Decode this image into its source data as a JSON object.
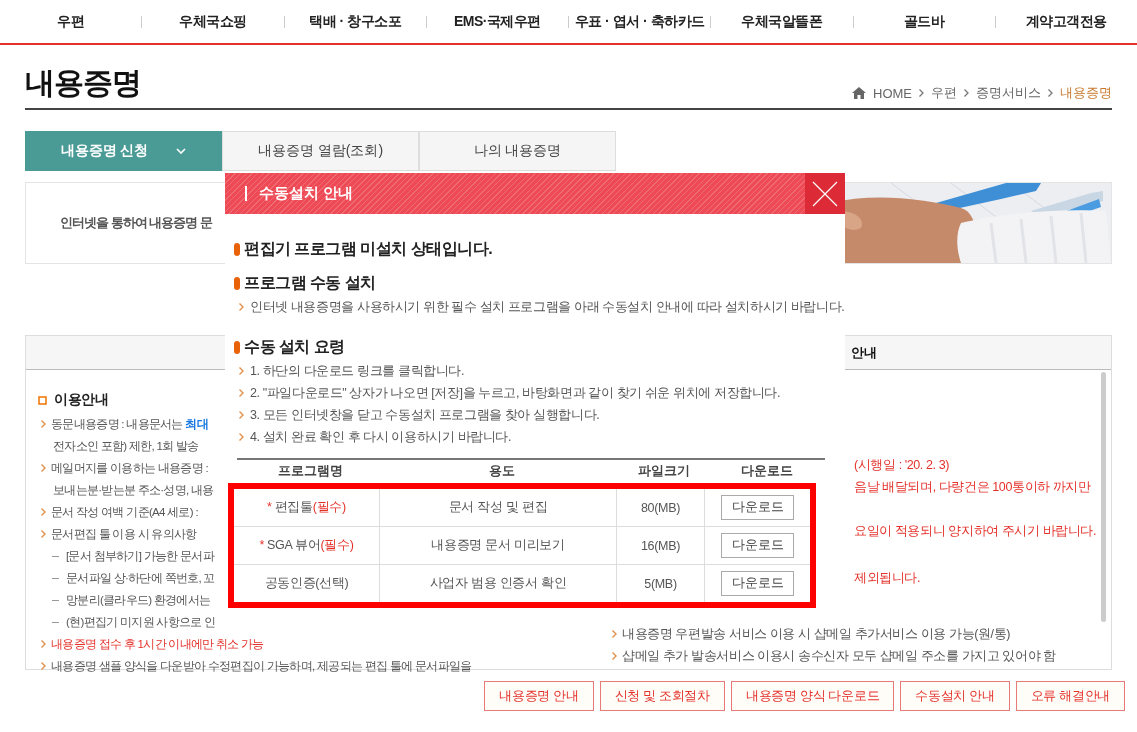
{
  "nav": [
    "우편",
    "우체국쇼핑",
    "택배 · 창구소포",
    "EMS·국제우편",
    "우표 · 엽서 · 축하카드",
    "우체국알뜰폰",
    "골드바",
    "계약고객전용"
  ],
  "page_title": "내용증명",
  "breadcrumb": [
    {
      "kind": "home",
      "label": "HOME",
      "selected": false
    },
    {
      "kind": "link",
      "label": "우편",
      "selected": false
    },
    {
      "kind": "link",
      "label": "증명서비스",
      "selected": false
    },
    {
      "kind": "link",
      "label": "내용증명",
      "selected": true
    }
  ],
  "tabs": [
    {
      "label": "내용증명 신청",
      "selected": true
    },
    {
      "label": "내용증명 열람(조회)",
      "selected": false
    },
    {
      "label": "나의 내용증명",
      "selected": false
    }
  ],
  "intro": {
    "text": "인터넷을 통하여 내용증명 문"
  },
  "info": {
    "header": "안내",
    "left": [
      {
        "kind": "heading",
        "text": "이용안내",
        "alert": false
      },
      {
        "kind": "bullet",
        "text": "동문내용증명 : 내용문서는 **최대**",
        "alert": false
      },
      {
        "kind": "cont",
        "text": "전자소인 포함) 제한, 1회 발송",
        "alert": false
      },
      {
        "kind": "bullet",
        "text": "메일머지를 이용하는 내용증명 :",
        "alert": false
      },
      {
        "kind": "cont",
        "text": "보내는분·받는분 주소·성명, 내용",
        "alert": false
      },
      {
        "kind": "bullet",
        "text": "문서 작성 여백 기준(A4 세로) :",
        "alert": false
      },
      {
        "kind": "bullet",
        "text": "문서편집 툴 이용 시 유의사항",
        "alert": false
      },
      {
        "kind": "dash",
        "text": "[문서 첨부하기] 가능한 문서파",
        "alert": false
      },
      {
        "kind": "dash",
        "text": "문서파일 상·하단에 쪽번호, 꼬",
        "alert": false
      },
      {
        "kind": "dash",
        "text": "망분리(클라우드) 환경에서는",
        "alert": false
      },
      {
        "kind": "dash",
        "text": "(현)편집기 미지원 사항으로 인",
        "alert": false
      },
      {
        "kind": "bullet",
        "text": "내용증명 접수 후 1시간 이내에만 취소 가능",
        "alert": true
      },
      {
        "kind": "bullet",
        "text": "내용증명 샘플 양식을 다운받아 수정편집이 가능하며, 제공되는 편집 툴에 문서파일을",
        "alert": false
      }
    ],
    "right": [
      {
        "kind": "tail",
        "text": "(시행일 : '20. 2. 3)",
        "alert": true
      },
      {
        "kind": "tail",
        "text": "음날 배달되며, 다량건은 100통이하 까지만",
        "alert": true
      },
      {
        "kind": "tail",
        "text": "요일이 적용되니 양지하여 주시기 바랍니다.",
        "alert": true
      },
      {
        "kind": "tail",
        "text": "제외됩니다.",
        "alert": true
      },
      {
        "kind": "bullet",
        "text": "내용증명 우편발송 서비스 이용 시 샵메일 추가서비스 이용 가능(원/통)",
        "alert": false
      },
      {
        "kind": "bullet",
        "text": "샵메일 추가 발송서비스 이용시 송수신자 모두 샵메일 주소를 가지고 있어야 함",
        "alert": false
      }
    ]
  },
  "bottom_buttons": [
    "내용증명 안내",
    "신청 및 조회절차",
    "내용증명 양식 다운로드",
    "수동설치 안내",
    "오류 해결안내"
  ],
  "dialog": {
    "title": "수동설치 안내",
    "sections": [
      {
        "heading": "편집기 프로그램 미설치 상태입니다."
      },
      {
        "heading": "프로그램 수동 설치",
        "lines": [
          "인터넷 내용증명을 사용하시기 위한 필수 설치 프로그램을 아래 수동설치 안내에 따라 설치하시기 바랍니다."
        ]
      },
      {
        "heading": "수동 설치 요령",
        "lines": [
          "1. 하단의 다운로드 링크를 클릭합니다.",
          "2. \"파일다운로드\" 상자가 나오면 [저장]을 누르고, 바탕화면과 같이 찾기 쉬운 위치에 저장합니다.",
          "3. 모든 인터넷창을 닫고 수동설치 프로그램을 찾아 실행합니다.",
          "4. 설치 완료 확인 후 다시 이용하시기 바랍니다."
        ]
      }
    ],
    "table": {
      "columns": [
        "프로그램명",
        "용도",
        "파일크기",
        "다운로드"
      ],
      "highlighted": true,
      "rows": [
        {
          "mark": "*",
          "name": "편집툴",
          "tag": "(필수)",
          "purpose": "문서 작성 및 편집",
          "size": "80(MB)",
          "button": "다운로드"
        },
        {
          "mark": "*",
          "name": "SGA 뷰어",
          "tag": "(필수)",
          "purpose": "내용증명 문서 미리보기",
          "size": "16(MB)",
          "button": "다운로드"
        },
        {
          "name": "공동인증(선택)",
          "purpose": "사업자 범용 인증서 확인",
          "size": "5(MB)",
          "button": "다운로드"
        }
      ]
    }
  }
}
